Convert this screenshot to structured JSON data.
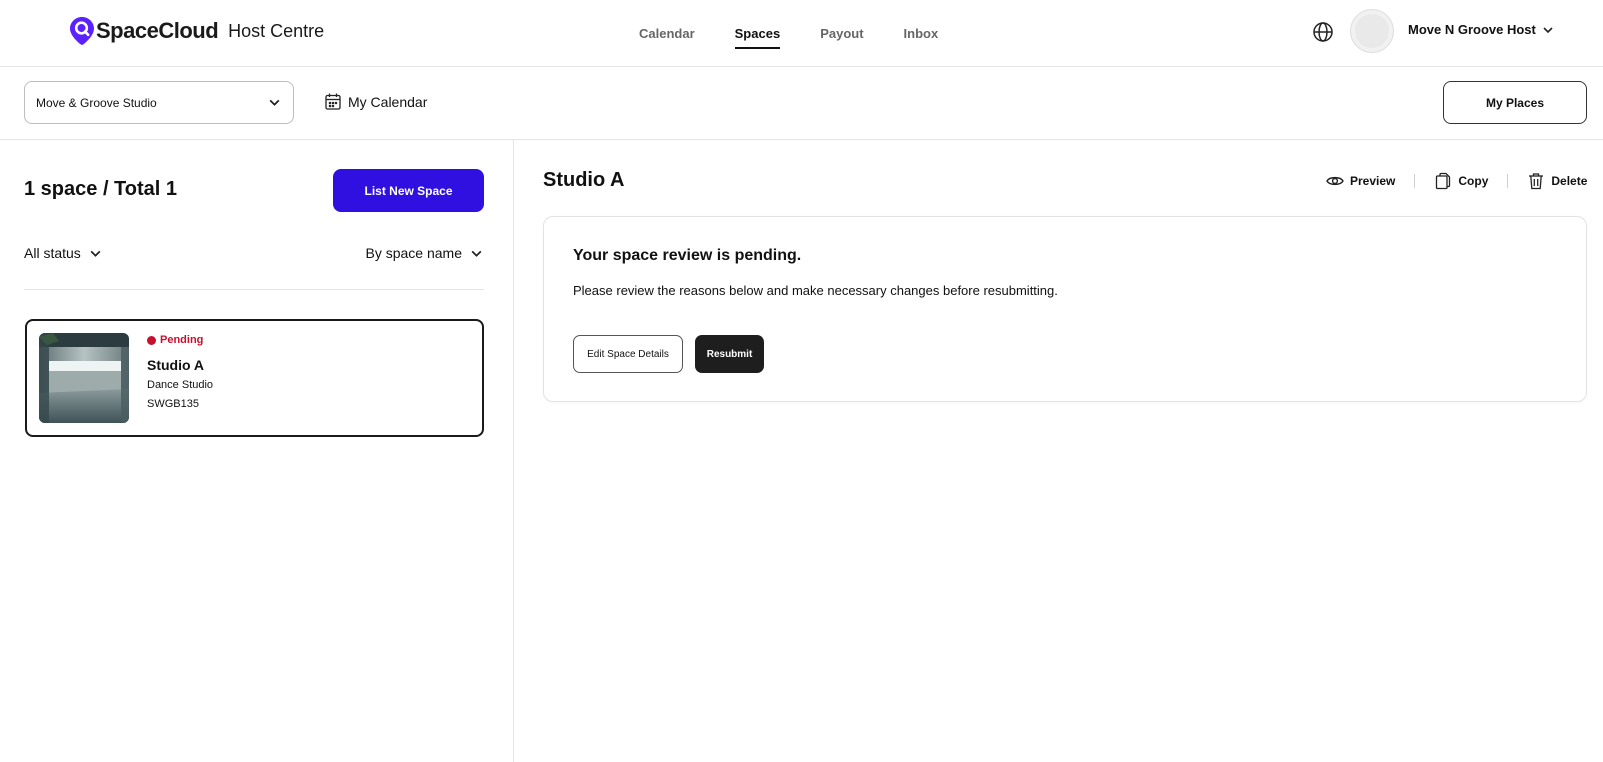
{
  "brand": {
    "logo_text": "SpaceCloud",
    "section": "Host Centre",
    "accent": "#5b21ff"
  },
  "nav": {
    "tabs": [
      {
        "label": "Calendar",
        "active": false
      },
      {
        "label": "Spaces",
        "active": true
      },
      {
        "label": "Payout",
        "active": false
      },
      {
        "label": "Inbox",
        "active": false
      }
    ],
    "user_name": "Move N Groove Host"
  },
  "toolbar": {
    "venue_selected": "Move & Groove Studio",
    "my_calendar_label": "My Calendar",
    "my_places_label": "My Places"
  },
  "left": {
    "count_text": "1 space / Total 1",
    "list_new_label": "List New Space",
    "list_new_color": "#3010e0",
    "status_filter": "All status",
    "sort_filter": "By space name",
    "spaces": [
      {
        "status": "Pending",
        "status_color": "#c8102e",
        "name": "Studio A",
        "type": "Dance Studio",
        "code": "SWGB135"
      }
    ]
  },
  "detail": {
    "title": "Studio A",
    "actions": {
      "preview": "Preview",
      "copy": "Copy",
      "delete": "Delete"
    },
    "review": {
      "heading": "Your space review is pending.",
      "message": "Please review the reasons below and make necessary changes before resubmitting.",
      "edit_label": "Edit Space Details",
      "resubmit_label": "Resubmit"
    }
  }
}
